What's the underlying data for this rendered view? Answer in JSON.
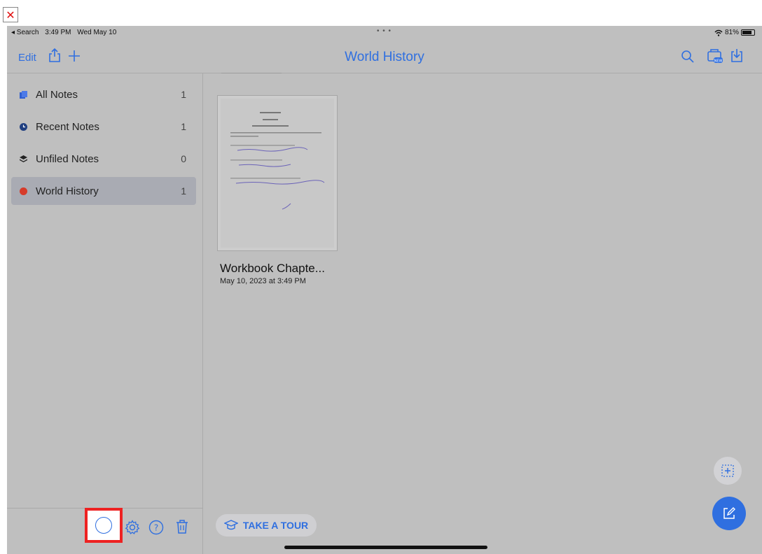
{
  "status_bar": {
    "back_app": "◂ Search",
    "time": "3:49 PM",
    "date": "Wed May 10",
    "battery": "81%"
  },
  "toolbar": {
    "edit_label": "Edit",
    "title": "World History"
  },
  "sidebar": {
    "items": [
      {
        "label": "All Notes",
        "count": "1",
        "color": "#2f5fd0"
      },
      {
        "label": "Recent Notes",
        "count": "1",
        "color": "#1f3f80"
      },
      {
        "label": "Unfiled Notes",
        "count": "0",
        "color": "#222222"
      },
      {
        "label": "World History",
        "count": "1",
        "color": "#d63b2a"
      }
    ],
    "active_item": "World History"
  },
  "notes": [
    {
      "title": "Workbook Chapte...",
      "date": "May 10, 2023 at 3:49 PM"
    }
  ],
  "tour_button": {
    "label": "TAKE A TOUR"
  },
  "colors": {
    "accent": "#2f6fe0",
    "highlight": "#ee2222",
    "background": "#bfbfbf"
  },
  "icons": [
    "close-icon",
    "share-icon",
    "plus-icon",
    "search-icon",
    "import-icon",
    "download-icon",
    "spinner-icon",
    "gear-icon",
    "help-icon",
    "trash-icon",
    "graduation-cap-icon",
    "add-frame-icon",
    "compose-icon"
  ]
}
